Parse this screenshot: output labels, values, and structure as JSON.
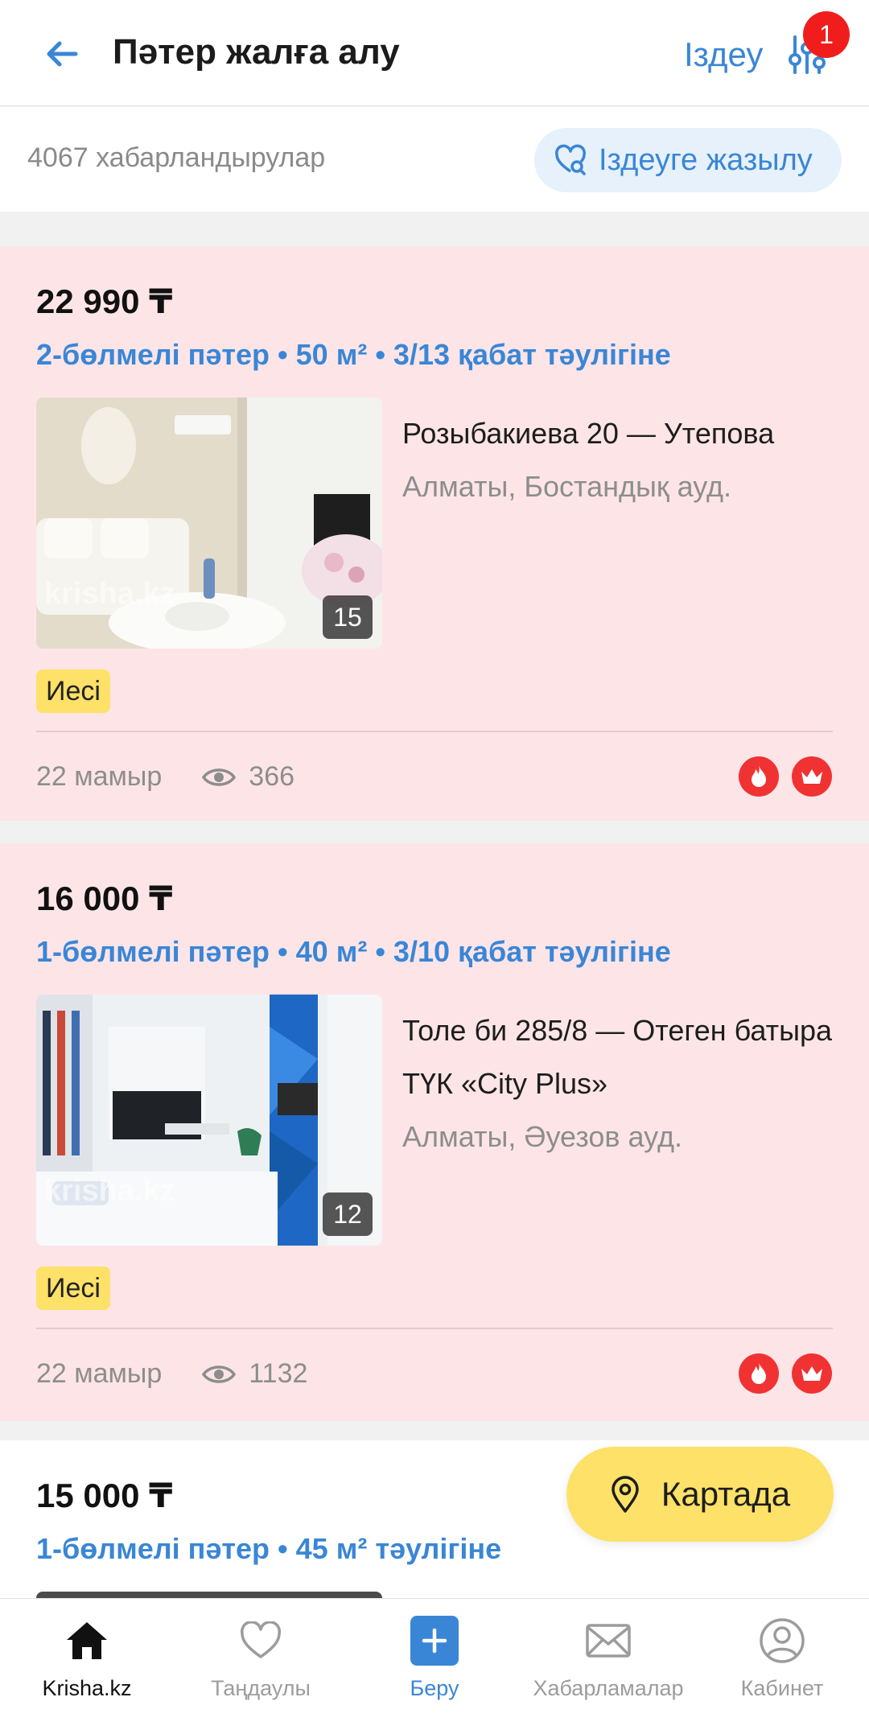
{
  "header": {
    "title": "Пәтер жалға алу",
    "search_label": "Іздеу",
    "filter_badge": "1"
  },
  "subbar": {
    "count": "4067 хабарландырулар",
    "subscribe_label": "Іздеуге жазылу"
  },
  "listings": [
    {
      "price": "22 990 ₸",
      "subtitle": "2-бөлмелі пәтер • 50 м² • 3/13 қабат тәулігіне",
      "address": "Розыбакиева 20 — Утепова",
      "complex": "",
      "district": "Алматы, Бостандық ауд.",
      "photo_count": "15",
      "watermark": "krisha.kz",
      "owner_tag": "Иесі",
      "date": "22 мамыр",
      "views": "366"
    },
    {
      "price": "16 000 ₸",
      "subtitle": "1-бөлмелі пәтер • 40 м² • 3/10 қабат тәулігіне",
      "address": "Толе би 285/8 — Отеген батыра",
      "complex": "ТҮК «City Plus»",
      "district": "Алматы, Әуезов ауд.",
      "photo_count": "12",
      "watermark": "krisha.kz",
      "owner_tag": "Иесі",
      "date": "22 мамыр",
      "views": "1132"
    },
    {
      "price": "15 000 ₸",
      "subtitle": "1-бөлмелі пәтер • 45 м² тәулігіне"
    }
  ],
  "map_button": "Картада",
  "bottom_nav": [
    {
      "label": "Krisha.kz",
      "icon": "home-icon"
    },
    {
      "label": "Таңдаулы",
      "icon": "heart-icon"
    },
    {
      "label": "Беру",
      "icon": "plus-icon"
    },
    {
      "label": "Хабарламалар",
      "icon": "mail-icon"
    },
    {
      "label": "Кабинет",
      "icon": "user-icon"
    }
  ],
  "colors": {
    "accent": "#3a86d6",
    "card_bg": "#fde5e7",
    "tag_yellow": "#fde168",
    "badge_red": "#f11d1d"
  }
}
